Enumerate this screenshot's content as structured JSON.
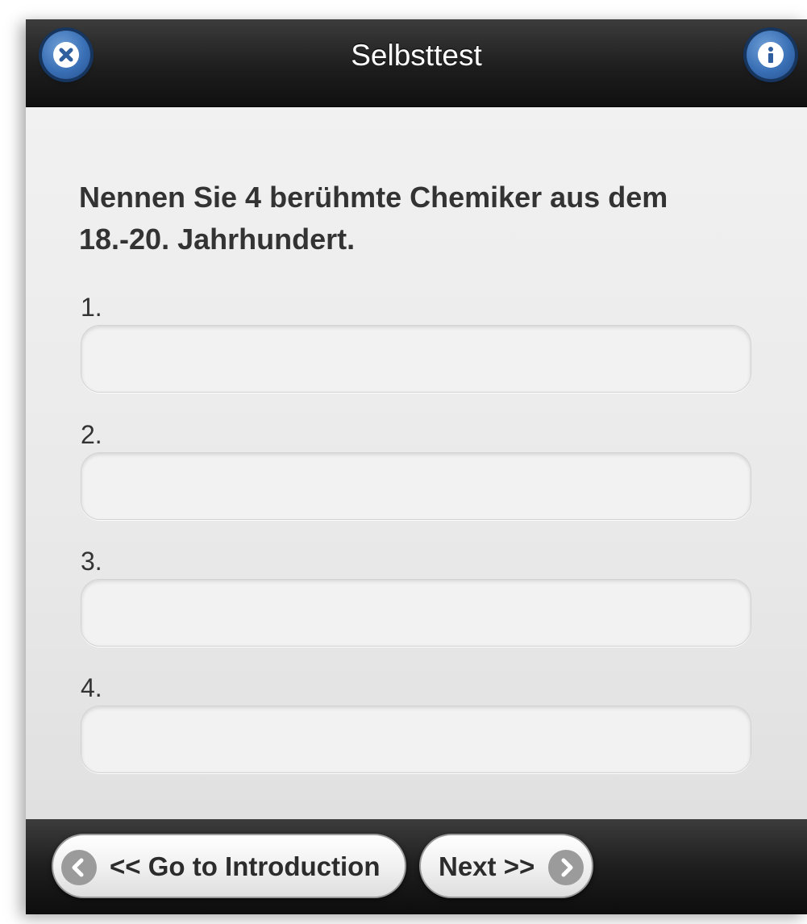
{
  "header": {
    "title": "Selbsttest",
    "close_icon": "close-icon",
    "info_icon": "info-icon"
  },
  "quiz": {
    "question": "Nennen Sie 4 berühmte Chemiker aus dem 18.-20. Jahrhundert.",
    "answers": [
      {
        "label": "1.",
        "value": ""
      },
      {
        "label": "2.",
        "value": ""
      },
      {
        "label": "3.",
        "value": ""
      },
      {
        "label": "4.",
        "value": ""
      }
    ]
  },
  "footer": {
    "prev_label": "<< Go to Introduction",
    "next_label": "Next >>",
    "prev_icon": "arrow-left-icon",
    "next_icon": "arrow-right-icon"
  },
  "colors": {
    "bar_dark": "#1e1e1e",
    "accent_blue": "#3a70b6",
    "content_bg": "#ececec"
  }
}
